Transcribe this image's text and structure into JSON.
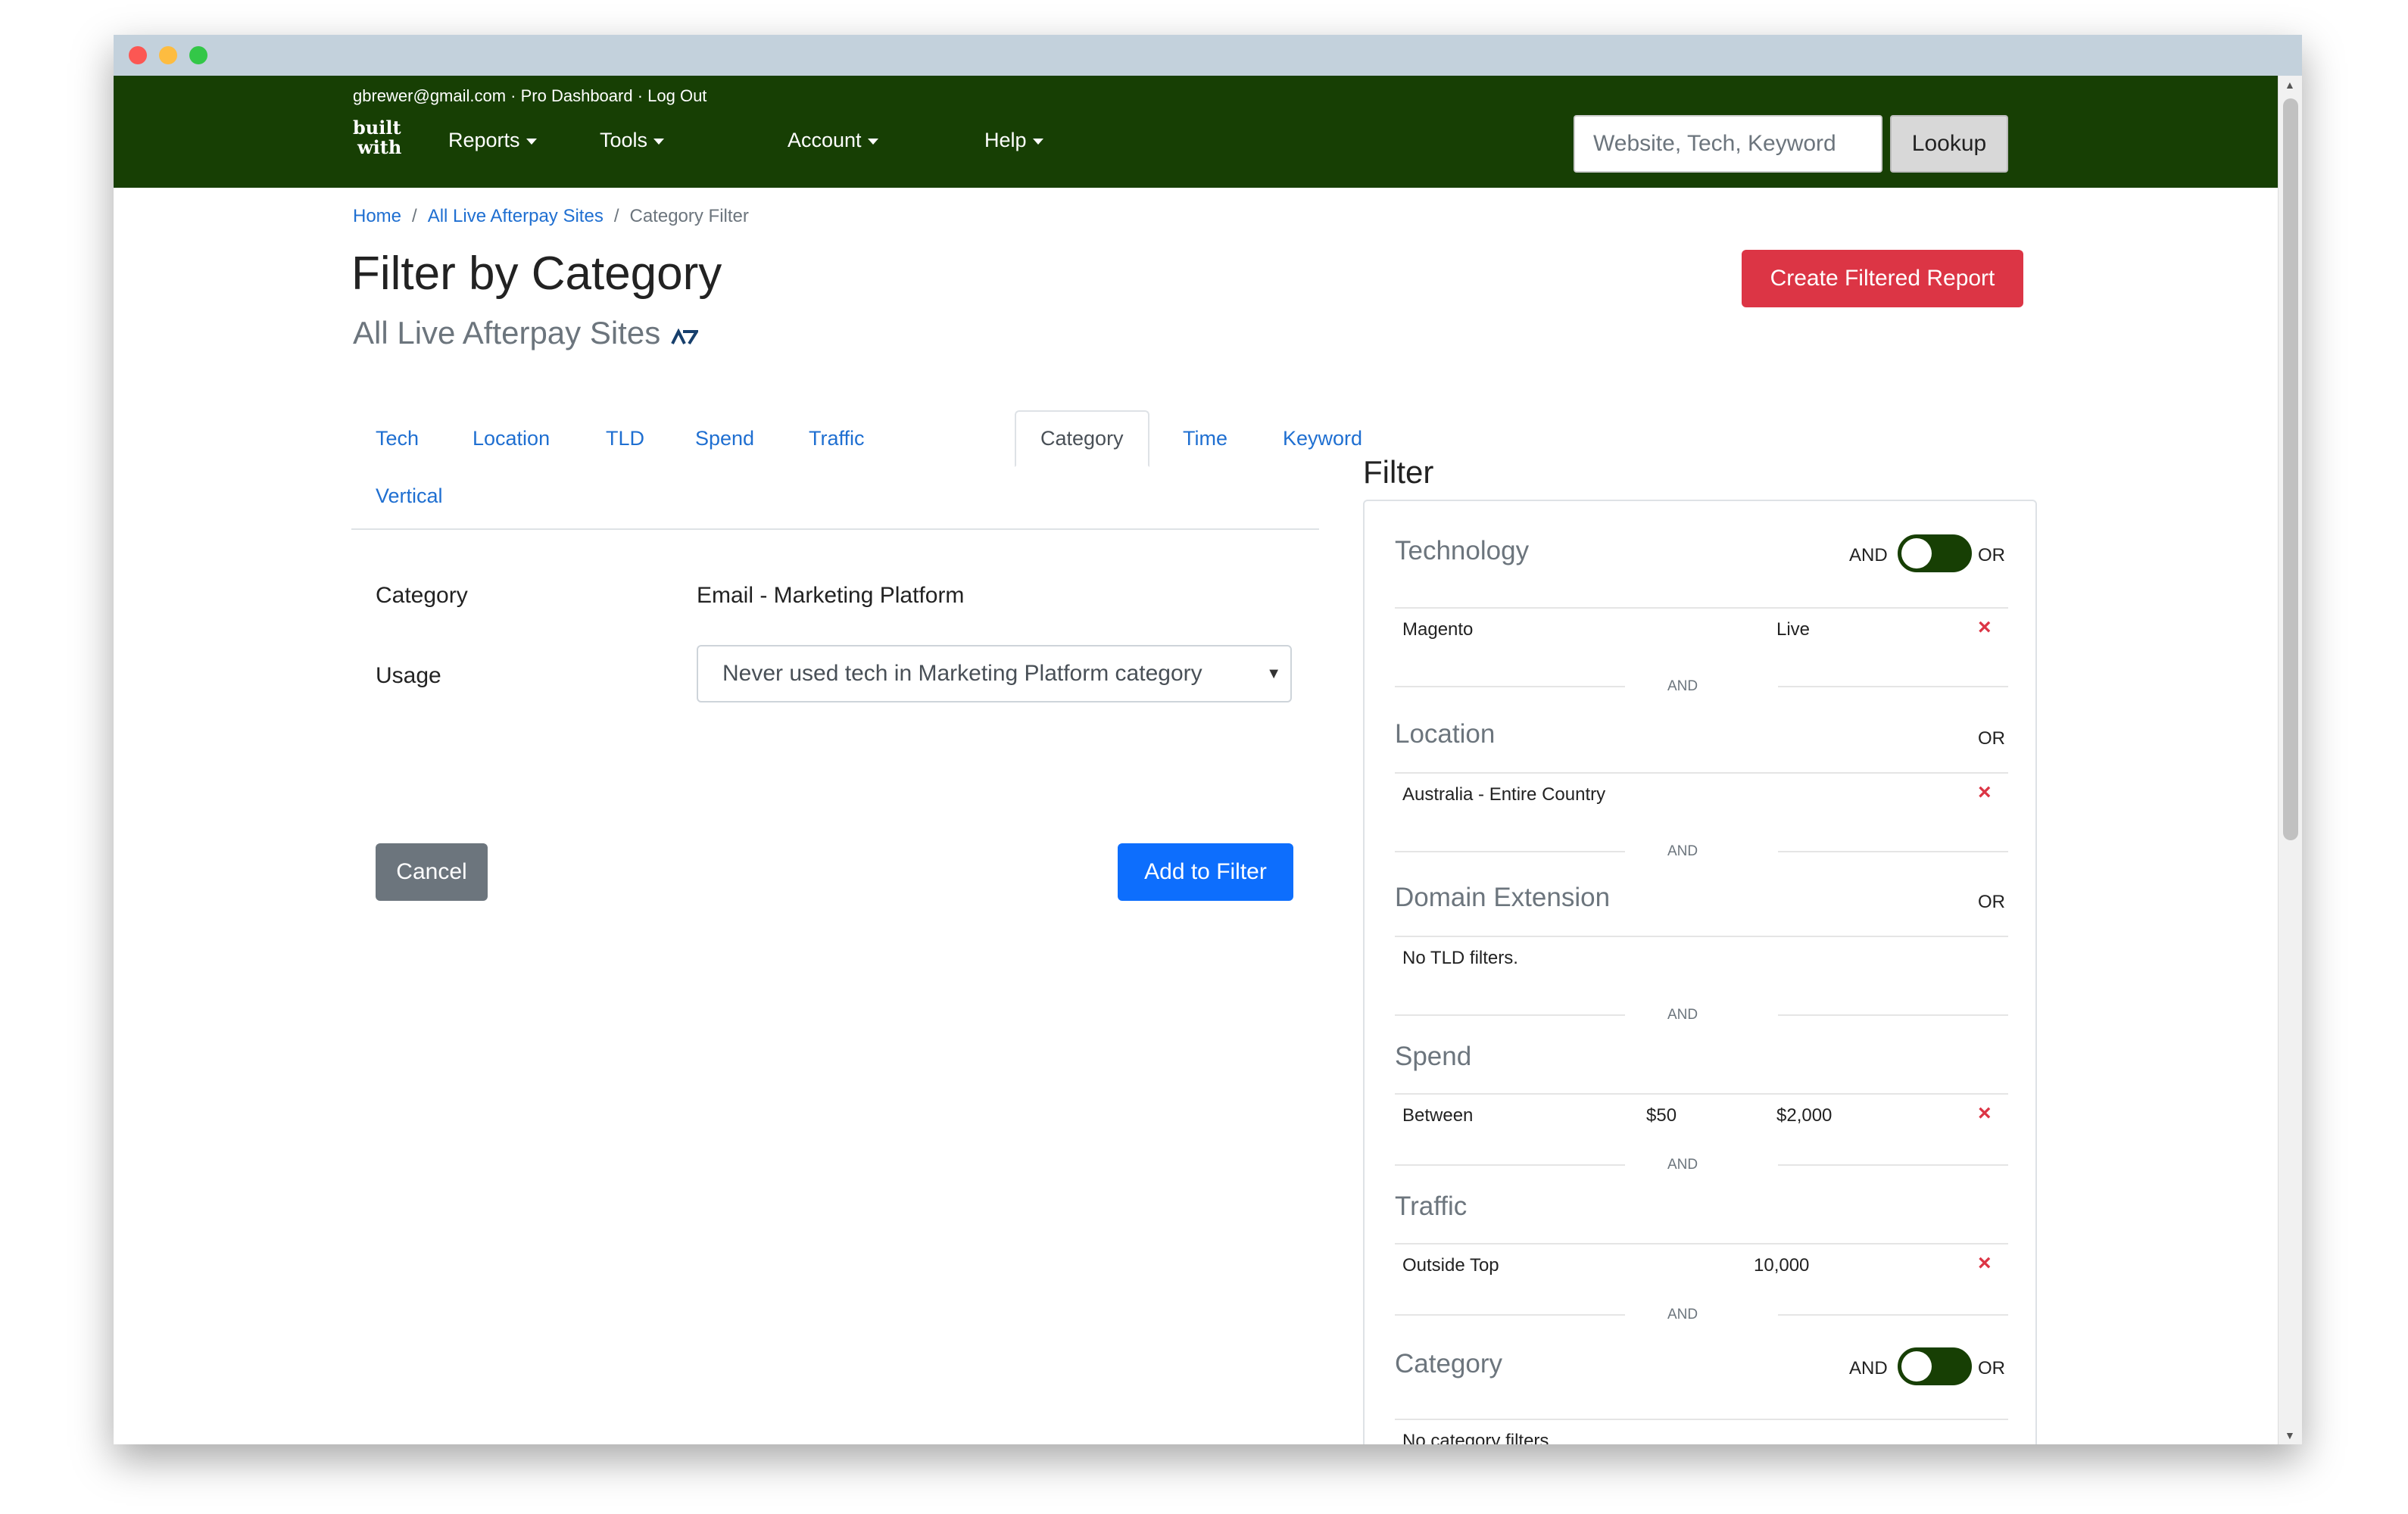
{
  "header": {
    "user_menu": "gbrewer@gmail.com · Pro Dashboard · Log Out",
    "logo_text_top": "built",
    "logo_text_bottom": "with",
    "nav": [
      {
        "label": "Reports"
      },
      {
        "label": "Tools"
      },
      {
        "label": "Account"
      },
      {
        "label": "Help"
      }
    ],
    "search_placeholder": "Website, Tech, Keyword",
    "lookup_label": "Lookup"
  },
  "breadcrumb": [
    "Home",
    "All Live Afterpay Sites",
    "Category Filter"
  ],
  "page": {
    "title": "Filter by Category",
    "subtitle": "All Live Afterpay Sites",
    "create_button": "Create Filtered Report"
  },
  "tabs": [
    "Tech",
    "Location",
    "TLD",
    "Spend",
    "Traffic",
    "Category",
    "Time",
    "Keyword",
    "Vertical"
  ],
  "active_tab": "Category",
  "form": {
    "category_label": "Category",
    "category_value": "Email - Marketing Platform",
    "usage_label": "Usage",
    "usage_selected": "Never used tech in Marketing Platform category",
    "cancel_label": "Cancel",
    "add_label": "Add to Filter"
  },
  "filter": {
    "title": "Filter",
    "and_label": "AND",
    "or_label": "OR",
    "technology": {
      "title": "Technology",
      "item": "Magento",
      "status": "Live"
    },
    "location": {
      "title": "Location",
      "item": "Australia - Entire Country"
    },
    "domain_extension": {
      "title": "Domain Extension",
      "empty": "No TLD filters."
    },
    "spend": {
      "title": "Spend",
      "label": "Between",
      "min": "$50",
      "max": "$2,000"
    },
    "traffic": {
      "title": "Traffic",
      "label": "Outside Top",
      "value": "10,000"
    },
    "category": {
      "title": "Category",
      "empty": "No category filters."
    },
    "remove_glyph": "×"
  },
  "colors": {
    "navbar": "#173f04",
    "link": "#1f6fd1",
    "danger": "#dc3545",
    "primary": "#0d6efd",
    "secondary": "#6c757d"
  }
}
